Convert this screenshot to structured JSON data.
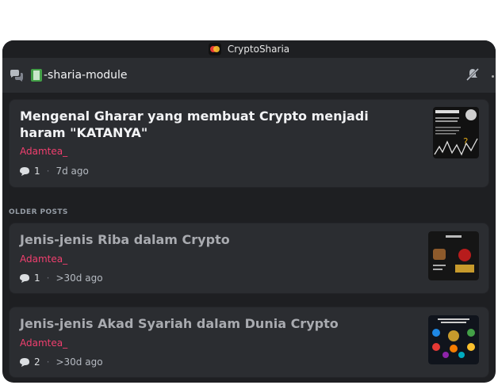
{
  "window": {
    "title": "CryptoSharia"
  },
  "channel": {
    "name": "-sharia-module"
  },
  "posts": [
    {
      "title": "Mengenal Gharar yang membuat Crypto menjadi haram \"KATANYA\"",
      "author": "Adamtea_",
      "replies": "1",
      "time": "7d ago"
    }
  ],
  "older": {
    "label": "OLDER POSTS",
    "posts": [
      {
        "title": "Jenis-jenis Riba dalam Crypto",
        "author": "Adamtea_",
        "replies": "1",
        "time": ">30d ago"
      },
      {
        "title": "Jenis-jenis Akad Syariah dalam Dunia Crypto",
        "author": "Adamtea_",
        "replies": "2",
        "time": ">30d ago"
      }
    ]
  },
  "colors": {
    "accent_author": "#f23f6f",
    "background": "#1e1f22",
    "card": "#2b2d31"
  },
  "icons": [
    "forum-icon",
    "book-emoji-icon",
    "mute-icon",
    "chat-bubble-icon"
  ]
}
